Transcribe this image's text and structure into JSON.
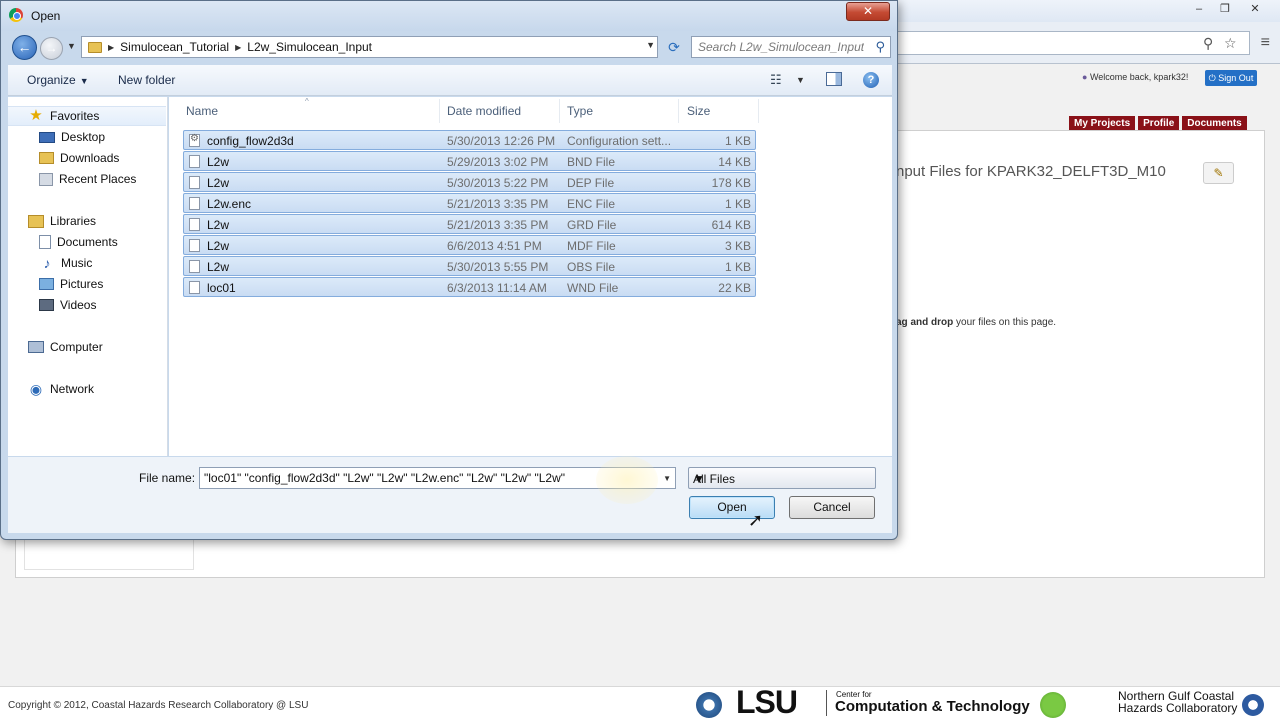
{
  "browser": {
    "minimize": "–",
    "maximize": "❐",
    "close": "✕",
    "zoom_icon": "⚲",
    "star_icon": "☆",
    "menu_icon": "≡",
    "welcome": "Welcome back, kpark32!",
    "sign_out": "Sign Out",
    "nav_tabs": [
      "My Projects",
      "Profile",
      "Documents"
    ],
    "panel_title": "nput Files for KPARK32_DELFT3D_M10",
    "edit_icon": "✎",
    "drop_prefix": "ag and drop",
    "drop_suffix": " your files on this page.",
    "copyright": "Copyright © 2012, Coastal Hazards Research Collaboratory @ LSU",
    "lsu": "LSU",
    "cct_small": "Center for",
    "cct": "Computation & Technology",
    "ngc_line1": "Northern Gulf Coastal",
    "ngc_line2": "Hazards Collaboratory"
  },
  "dialog": {
    "title": "Open",
    "close_label": "✕",
    "back_icon": "←",
    "forward_icon": "→",
    "recent_icon": "▼",
    "breadcrumb": [
      "Simulocean_Tutorial",
      "L2w_Simulocean_Input"
    ],
    "breadcrumb_sep": "▶",
    "dropdown_icon": "▼",
    "refresh_icon": "⟳",
    "search_placeholder": "Search L2w_Simulocean_Input",
    "search_icon": "⚲",
    "organize": "Organize",
    "new_folder": "New folder",
    "view_icon": "☷",
    "help_label": "?"
  },
  "nav_pane": {
    "favorites": "Favorites",
    "favorites_items": [
      "Desktop",
      "Downloads",
      "Recent Places"
    ],
    "libraries": "Libraries",
    "libraries_items": [
      "Documents",
      "Music",
      "Pictures",
      "Videos"
    ],
    "computer": "Computer",
    "network": "Network",
    "star_icon": "★",
    "music_icon": "♪",
    "network_icon": "◉"
  },
  "file_list": {
    "columns": [
      "Name",
      "Date modified",
      "Type",
      "Size"
    ],
    "sort_indicator": "^",
    "rows": [
      {
        "name": "config_flow2d3d",
        "date": "5/30/2013 12:26 PM",
        "type": "Configuration sett...",
        "size": "1 KB"
      },
      {
        "name": "L2w",
        "date": "5/29/2013 3:02 PM",
        "type": "BND File",
        "size": "14 KB"
      },
      {
        "name": "L2w",
        "date": "5/30/2013 5:22 PM",
        "type": "DEP File",
        "size": "178 KB"
      },
      {
        "name": "L2w.enc",
        "date": "5/21/2013 3:35 PM",
        "type": "ENC File",
        "size": "1 KB"
      },
      {
        "name": "L2w",
        "date": "5/21/2013 3:35 PM",
        "type": "GRD File",
        "size": "614 KB"
      },
      {
        "name": "L2w",
        "date": "6/6/2013 4:51 PM",
        "type": "MDF File",
        "size": "3 KB"
      },
      {
        "name": "L2w",
        "date": "5/30/2013 5:55 PM",
        "type": "OBS File",
        "size": "1 KB"
      },
      {
        "name": "loc01",
        "date": "6/3/2013 11:14 AM",
        "type": "WND File",
        "size": "22 KB"
      }
    ]
  },
  "bottom": {
    "file_name_label": "File name:",
    "file_name_value": "\"loc01\" \"config_flow2d3d\" \"L2w\" \"L2w\" \"L2w.enc\" \"L2w\" \"L2w\" \"L2w\"",
    "filter": "All Files",
    "open": "Open",
    "cancel": "Cancel",
    "cursor_icon": "➚"
  }
}
